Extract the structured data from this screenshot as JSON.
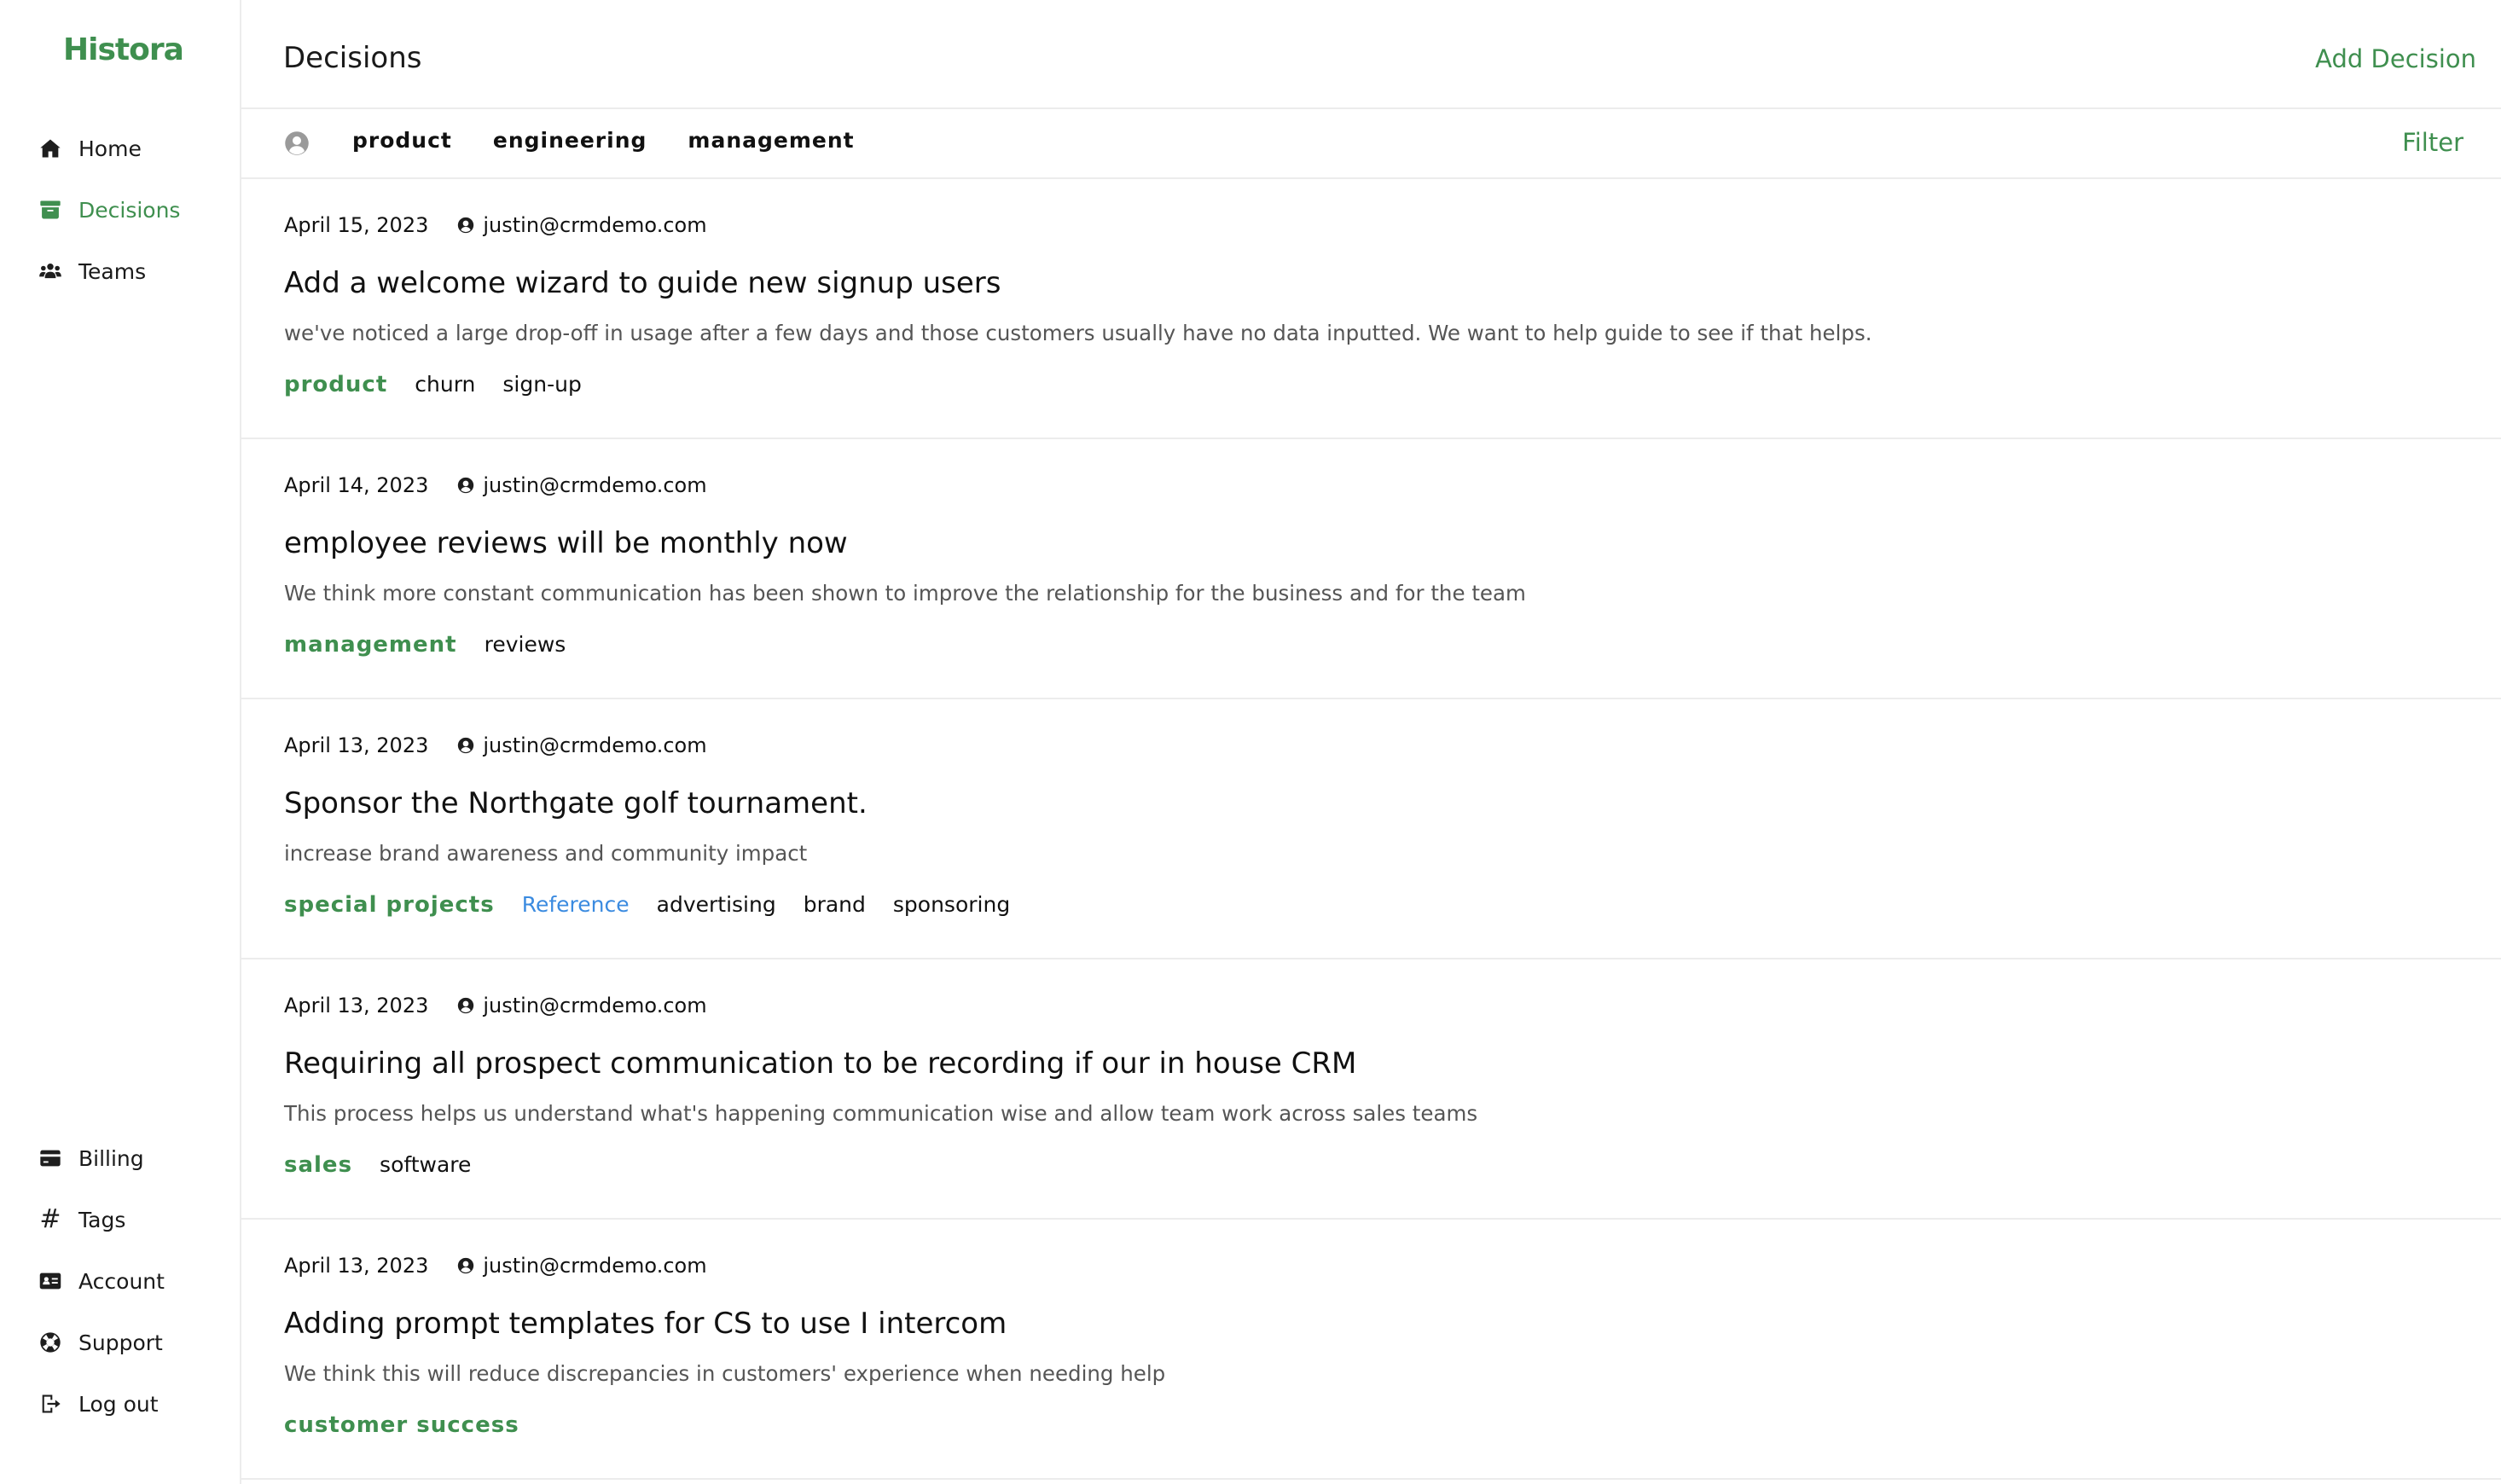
{
  "app": {
    "logo": "Histora"
  },
  "sidebar": {
    "top_items": [
      {
        "label": "Home",
        "icon": "home-icon"
      },
      {
        "label": "Decisions",
        "icon": "archive-icon",
        "active": true
      },
      {
        "label": "Teams",
        "icon": "users-icon"
      }
    ],
    "bottom_items": [
      {
        "label": "Billing",
        "icon": "credit-card-icon"
      },
      {
        "label": "Tags",
        "icon": "hashtag-icon"
      },
      {
        "label": "Account",
        "icon": "id-card-icon"
      },
      {
        "label": "Support",
        "icon": "lifebuoy-icon"
      },
      {
        "label": "Log out",
        "icon": "logout-icon"
      }
    ]
  },
  "header": {
    "title": "Decisions",
    "add_label": "Add Decision"
  },
  "filters": {
    "tags": [
      "product",
      "engineering",
      "management"
    ],
    "filter_label": "Filter"
  },
  "decisions": [
    {
      "date": "April 15, 2023",
      "author": "justin@crmdemo.com",
      "title": "Add a welcome wizard to guide new signup users",
      "description": "we've noticed a large drop-off in usage after a few days and those customers usually have no data inputted. We want to help guide to see if that helps.",
      "team": "product",
      "tags": [
        "churn",
        "sign-up"
      ]
    },
    {
      "date": "April 14, 2023",
      "author": "justin@crmdemo.com",
      "title": "employee reviews will be monthly now",
      "description": "We think more constant communication has been shown to improve the relationship for the business and for the team",
      "team": "management",
      "tags": [
        "reviews"
      ]
    },
    {
      "date": "April 13, 2023",
      "author": "justin@crmdemo.com",
      "title": "Sponsor the Northgate golf tournament.",
      "description": "increase brand awareness and community impact",
      "team": "special projects",
      "reference": "Reference",
      "tags": [
        "advertising",
        "brand",
        "sponsoring"
      ]
    },
    {
      "date": "April 13, 2023",
      "author": "justin@crmdemo.com",
      "title": "Requiring all prospect communication to be recording if our in house CRM",
      "description": "This process helps us understand what's happening communication wise and allow team work across sales teams",
      "team": "sales",
      "tags": [
        "software"
      ]
    },
    {
      "date": "April 13, 2023",
      "author": "justin@crmdemo.com",
      "title": "Adding prompt templates for CS to use I intercom",
      "description": "We think this will reduce discrepancies in customers' experience when needing help",
      "team": "customer success",
      "tags": []
    }
  ],
  "colors": {
    "accent": "#3f8f4f",
    "link": "#3b8be0",
    "border": "#ececec",
    "muted_text": "#555555"
  }
}
